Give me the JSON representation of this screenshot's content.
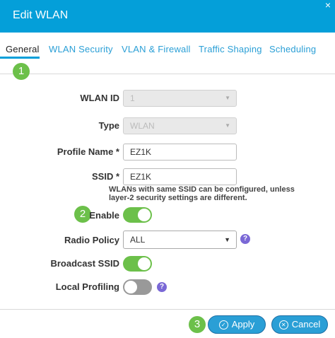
{
  "dialog": {
    "title": "Edit WLAN",
    "close_glyph": "×"
  },
  "tabs": [
    {
      "label": "General",
      "active": true
    },
    {
      "label": "WLAN Security"
    },
    {
      "label": "VLAN & Firewall"
    },
    {
      "label": "Traffic Shaping"
    },
    {
      "label": "Scheduling"
    }
  ],
  "steps": [
    "1",
    "2",
    "3"
  ],
  "form": {
    "wlan_id": {
      "label": "WLAN ID",
      "value": "1"
    },
    "type": {
      "label": "Type",
      "value": "WLAN"
    },
    "profile_name": {
      "label": "Profile Name *",
      "value": "EZ1K"
    },
    "ssid": {
      "label": "SSID *",
      "value": "EZ1K",
      "hint": "WLANs with same SSID can be configured, unless layer-2 security settings are different."
    },
    "enable": {
      "label": "Enable",
      "state": "on"
    },
    "radio_policy": {
      "label": "Radio Policy",
      "value": "ALL"
    },
    "broadcast_ssid": {
      "label": "Broadcast SSID",
      "state": "on"
    },
    "local_profiling": {
      "label": "Local Profiling",
      "state": "off"
    }
  },
  "buttons": {
    "apply": "Apply",
    "cancel": "Cancel"
  },
  "colors": {
    "header": "#049fd9",
    "accent": "#2a9fd6",
    "toggle_on": "#6cc04a",
    "step": "#6cc04a",
    "help": "#7a68d6"
  }
}
